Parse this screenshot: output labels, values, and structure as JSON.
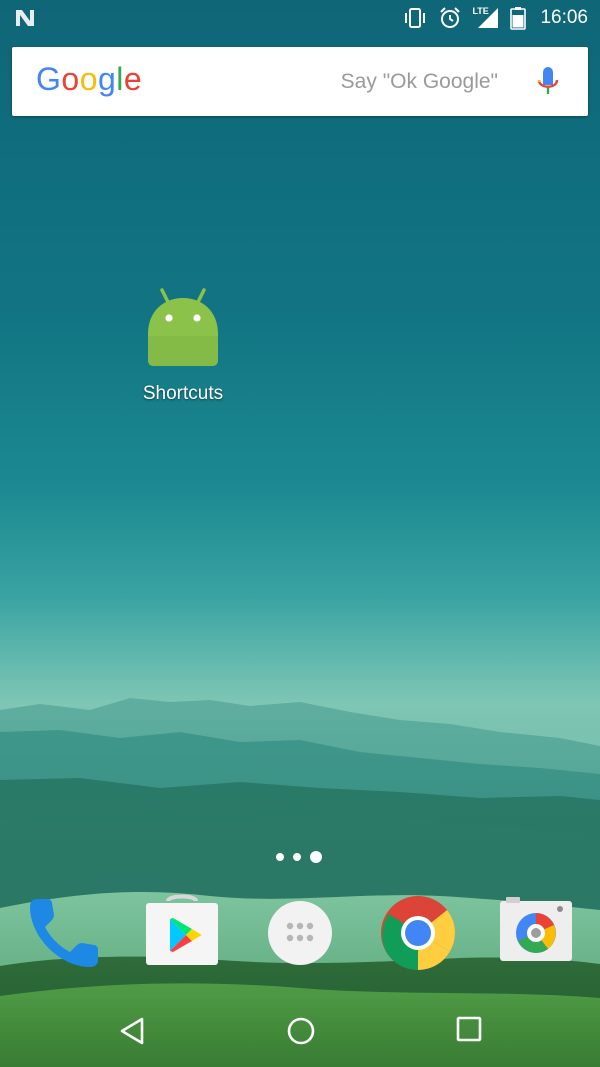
{
  "status_bar": {
    "time": "16:06",
    "network": "LTE",
    "icons": [
      "n-notification-icon",
      "vibrate-icon",
      "alarm-icon",
      "signal-icon",
      "battery-icon"
    ]
  },
  "search": {
    "logo": "Google",
    "placeholder": "Say \"Ok Google\"",
    "colors": {
      "blue": "#4285F4",
      "red": "#EA4335",
      "yellow": "#FBBC05",
      "green": "#34A853"
    }
  },
  "home": {
    "shortcut": {
      "label": "Shortcuts",
      "icon": "android-icon",
      "color": "#8BC34A"
    }
  },
  "page_indicator": {
    "count": 3,
    "active": 3
  },
  "dock": {
    "apps": [
      {
        "icon": "phone-icon"
      },
      {
        "icon": "play-store-icon"
      },
      {
        "icon": "app-drawer-icon"
      },
      {
        "icon": "chrome-icon"
      },
      {
        "icon": "camera-icon"
      }
    ]
  },
  "nav_bar": {
    "icons": [
      "back-icon",
      "home-icon",
      "recents-icon"
    ]
  }
}
